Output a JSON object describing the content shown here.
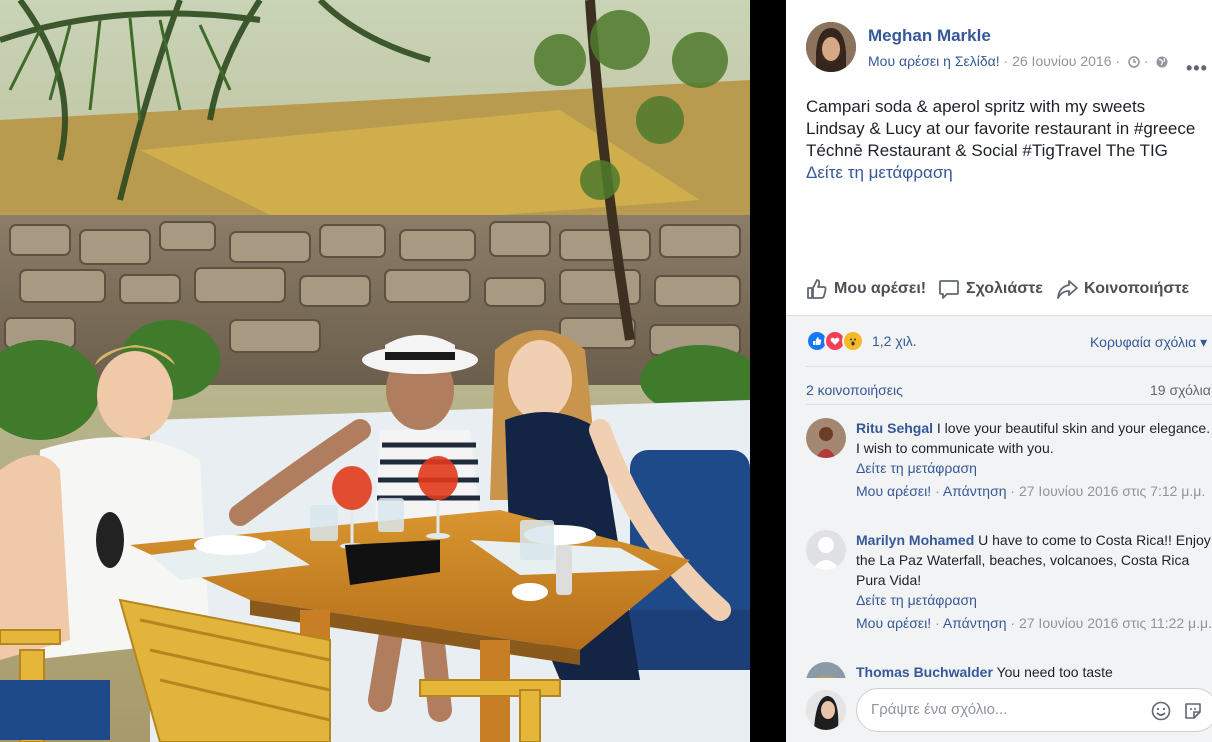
{
  "post": {
    "page_name": "Meghan Markle",
    "like_page": "Μου αρέσει η Σελίδα!",
    "separator": "·",
    "date": "26 Ιουνίου 2016",
    "caption_lines": [
      "Campari soda & aperol spritz with my sweets",
      "Lindsay & Lucy at our favorite restaurant in #greece",
      "Téchnē Restaurant & Social #TigTravel The TIG"
    ],
    "see_translation": "Δείτε τη μετάφραση"
  },
  "actions": {
    "like": "Μου αρέσει!",
    "comment": "Σχολιάστε",
    "share": "Κοινοποιήστε"
  },
  "stats": {
    "reactions_count": "1,2 χιλ.",
    "top_comments": "Κορυφαία σχόλια",
    "shares": "2 κοινοποιήσεις",
    "comments": "19 σχόλια"
  },
  "comments": [
    {
      "name": "Ritu Sehgal",
      "text": "I love your beautiful skin and your elegance. I wish to communicate with you.",
      "see_translation": "Δείτε τη μετάφραση",
      "like": "Μου αρέσει!",
      "reply": "Απάντηση",
      "time": "27 Ιουνίου 2016 στις 7:12 μ.μ."
    },
    {
      "name": "Marilyn Mohamed",
      "text": "U have to come to Costa Rica!! Enjoy the La Paz Waterfall, beaches, volcanoes, Costa Rica Pura Vida!",
      "see_translation": "Δείτε τη μετάφραση",
      "like": "Μου αρέσει!",
      "reply": "Απάντηση",
      "time": "27 Ιουνίου 2016 στις 11:22 μ.μ."
    },
    {
      "name": "Thomas Buchwalder",
      "text": "You need too taste"
    }
  ],
  "composer": {
    "placeholder": "Γράψτε ένα σχόλιο..."
  },
  "colors": {
    "link": "#365899",
    "panel_bg": "#f2f3f5",
    "like_blue": "#1877f2",
    "love_red": "#f33e58",
    "wow_yellow": "#f7b928"
  }
}
